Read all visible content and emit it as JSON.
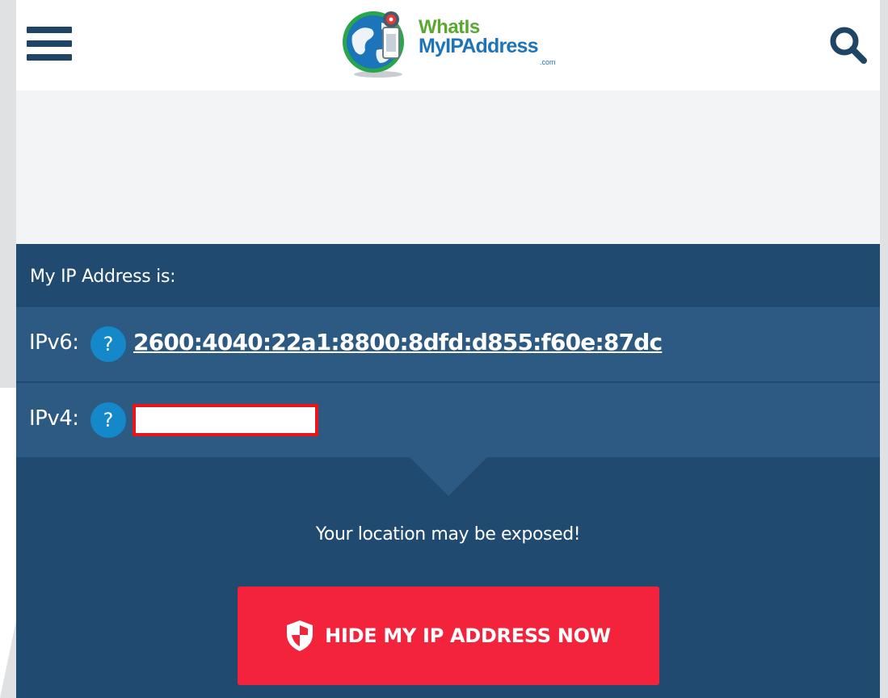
{
  "header": {
    "menu_icon": "hamburger-menu-icon",
    "logo": {
      "line1": "WhatIs",
      "line2": "MyIPAddress",
      "line3": ".com"
    },
    "search_icon": "search-icon"
  },
  "ip_panel": {
    "heading": "My IP Address is:",
    "ipv6": {
      "label": "IPv6:",
      "help": "?",
      "value": "2600:4040:22a1:8800:8dfd:d855:f60e:87dc"
    },
    "ipv4": {
      "label": "IPv4:",
      "help": "?",
      "value_redacted": true
    },
    "warning": "Your location may be exposed!",
    "hide_button": {
      "label": "HIDE MY IP ADDRESS NOW",
      "icon": "shield-icon"
    }
  },
  "colors": {
    "panel_dark": "#214a71",
    "panel_row": "#2d5a83",
    "help_blue": "#1488c9",
    "button_red": "#f2233a",
    "header_icon": "#1f4566",
    "logo_green": "#5aa830",
    "logo_blue": "#1c74bb"
  }
}
